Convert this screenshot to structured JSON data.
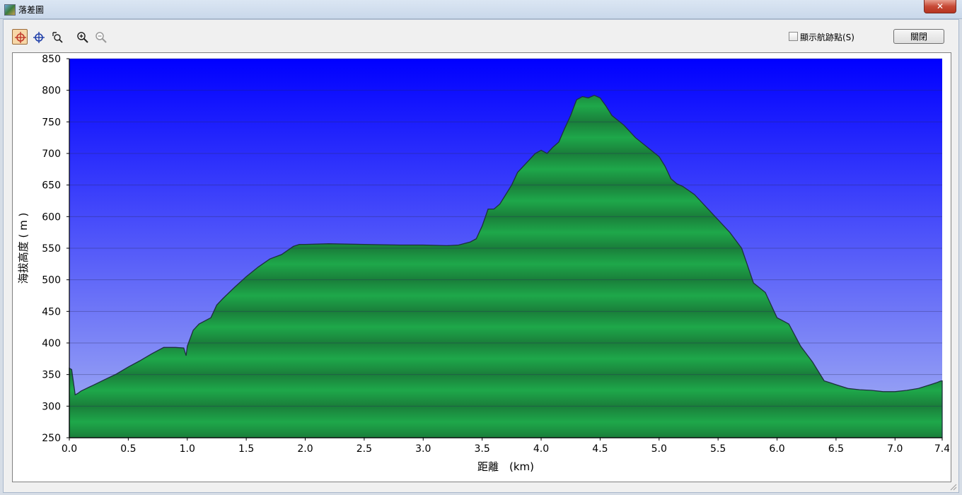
{
  "window": {
    "title": "落差圖",
    "close_symbol": "✕"
  },
  "toolbar": {
    "tools": [
      {
        "name": "crosshair-red-icon"
      },
      {
        "name": "crosshair-blue-icon"
      },
      {
        "name": "zoom-select-icon"
      },
      {
        "name": "zoom-in-icon"
      },
      {
        "name": "zoom-out-icon"
      }
    ],
    "show_points_label": "顯示航跡點(S)",
    "show_points_checked": false,
    "close_label": "關閉"
  },
  "colors": {
    "sky_top": "#0000ff",
    "sky_bottom": "#a7b3f3",
    "terrain": "#1ea84a",
    "terrain_dark": "#1a7e3a",
    "outline": "#1e2f3f"
  },
  "chart_data": {
    "type": "area",
    "xlabel": "距離　(km)",
    "ylabel": "海拔高度 ( m )",
    "xlim": [
      0.0,
      7.4
    ],
    "ylim": [
      250,
      850
    ],
    "x_ticks": [
      "0.0",
      "0.5",
      "1.0",
      "1.5",
      "2.0",
      "2.5",
      "3.0",
      "3.5",
      "4.0",
      "4.5",
      "5.0",
      "5.5",
      "6.0",
      "6.5",
      "7.0",
      "7.4"
    ],
    "y_ticks": [
      "850",
      "800",
      "750",
      "700",
      "650",
      "600",
      "550",
      "500",
      "450",
      "400",
      "350",
      "300",
      "250"
    ],
    "grid": true,
    "series": [
      {
        "x": [
          0.0,
          0.02,
          0.05,
          0.07,
          0.1,
          0.2,
          0.3,
          0.4,
          0.5,
          0.6,
          0.7,
          0.8,
          0.9,
          0.97,
          0.99,
          1.0,
          1.05,
          1.1,
          1.2,
          1.25,
          1.3,
          1.4,
          1.5,
          1.6,
          1.7,
          1.8,
          1.9,
          1.95,
          2.0,
          2.2,
          2.5,
          2.8,
          3.0,
          3.2,
          3.3,
          3.34,
          3.4,
          3.45,
          3.5,
          3.55,
          3.6,
          3.65,
          3.7,
          3.75,
          3.8,
          3.85,
          3.9,
          3.95,
          4.0,
          4.05,
          4.1,
          4.15,
          4.2,
          4.25,
          4.3,
          4.35,
          4.4,
          4.45,
          4.5,
          4.55,
          4.6,
          4.7,
          4.8,
          4.9,
          5.0,
          5.05,
          5.1,
          5.15,
          5.2,
          5.3,
          5.4,
          5.5,
          5.6,
          5.7,
          5.8,
          5.9,
          6.0,
          6.05,
          6.1,
          6.2,
          6.3,
          6.4,
          6.45,
          6.5,
          6.6,
          6.7,
          6.8,
          6.9,
          7.0,
          7.1,
          7.2,
          7.3,
          7.35,
          7.39,
          7.4
        ],
        "y": [
          360,
          358,
          318,
          320,
          324,
          333,
          342,
          351,
          362,
          372,
          383,
          393,
          393,
          392,
          380,
          395,
          420,
          430,
          440,
          460,
          470,
          488,
          505,
          520,
          533,
          540,
          553,
          556,
          556,
          557,
          556,
          555,
          555,
          554,
          555,
          557,
          560,
          565,
          585,
          612,
          612,
          620,
          635,
          650,
          670,
          680,
          690,
          700,
          705,
          700,
          710,
          718,
          740,
          760,
          785,
          790,
          788,
          792,
          788,
          775,
          760,
          745,
          725,
          710,
          695,
          680,
          660,
          652,
          648,
          635,
          615,
          595,
          575,
          550,
          495,
          480,
          440,
          435,
          430,
          395,
          370,
          340,
          337,
          334,
          328,
          326,
          325,
          323,
          323,
          325,
          328,
          334,
          337,
          340,
          340
        ]
      }
    ]
  }
}
